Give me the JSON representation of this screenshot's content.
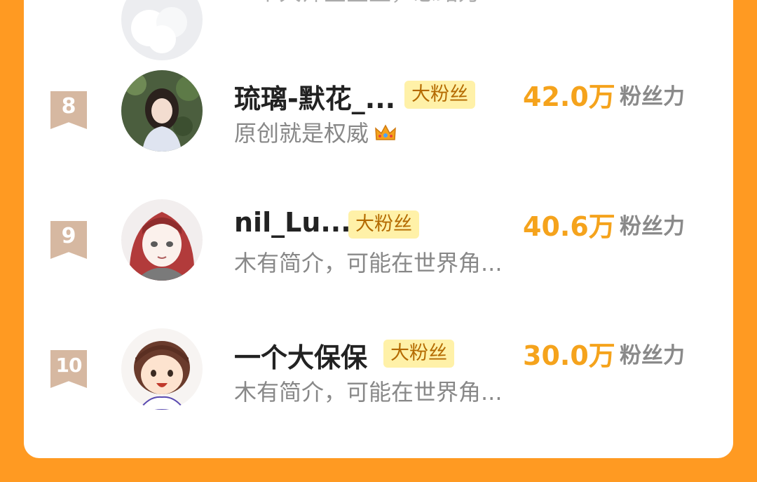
{
  "top_partial": {
    "bio": "一个大师星星生，思绪万..."
  },
  "rows": [
    {
      "rank": "8",
      "name": "琉璃-默花_...",
      "tag": "大粉丝",
      "bio": "原创就是权威",
      "bio_icon": "crown-icon",
      "score": "42.0万",
      "score_label": "粉丝力"
    },
    {
      "rank": "9",
      "name": "nil_Lu...",
      "tag": "大粉丝",
      "bio": "木有简介，可能在世界角...",
      "score": "40.6万",
      "score_label": "粉丝力"
    },
    {
      "rank": "10",
      "name": "一个大保保",
      "tag": "大粉丝",
      "bio": "木有简介，可能在世界角...",
      "score": "30.0万",
      "score_label": "粉丝力"
    }
  ],
  "colors": {
    "background": "#ff9a22",
    "score": "#f5a31c",
    "tag_bg": "#fff1a8",
    "rank_badge": "#d6b8a1"
  }
}
